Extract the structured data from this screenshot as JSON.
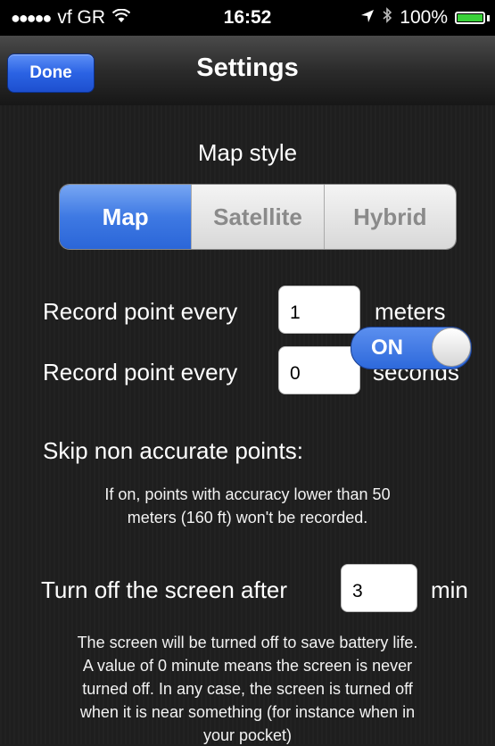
{
  "status_bar": {
    "signal_dots": "●●●●●",
    "carrier": "vf GR",
    "wifi_icon": "wifi-icon",
    "time": "16:52",
    "location_icon": "location-arrow-icon",
    "bluetooth_icon": "bluetooth-icon",
    "battery_percent": "100%"
  },
  "navbar": {
    "done_label": "Done",
    "title": "Settings"
  },
  "map_style": {
    "label": "Map style",
    "options": [
      "Map",
      "Satellite",
      "Hybrid"
    ],
    "selected": "Map"
  },
  "record_distance": {
    "label": "Record point every",
    "value": "1",
    "unit": "meters"
  },
  "record_time": {
    "label": "Record point every",
    "value": "0",
    "unit": "seconds"
  },
  "skip_inaccurate": {
    "label": "Skip non accurate points:",
    "toggle_text": "ON",
    "note_line1": "If on, points with accuracy lower than 50",
    "note_line2": "meters (160 ft) won't be recorded."
  },
  "screen_off": {
    "label": "Turn off the screen after",
    "value": "3",
    "unit": "min",
    "note_lines": [
      "The screen will be turned off to save battery life.",
      "A value of 0 minute means the screen is never",
      "turned off. In any case, the screen is turned off",
      "when it is near something (for instance when in",
      "your pocket)"
    ]
  },
  "colors": {
    "accent": "#2b66d8",
    "background": "#1e1e1e",
    "battery": "#3ad13a"
  }
}
